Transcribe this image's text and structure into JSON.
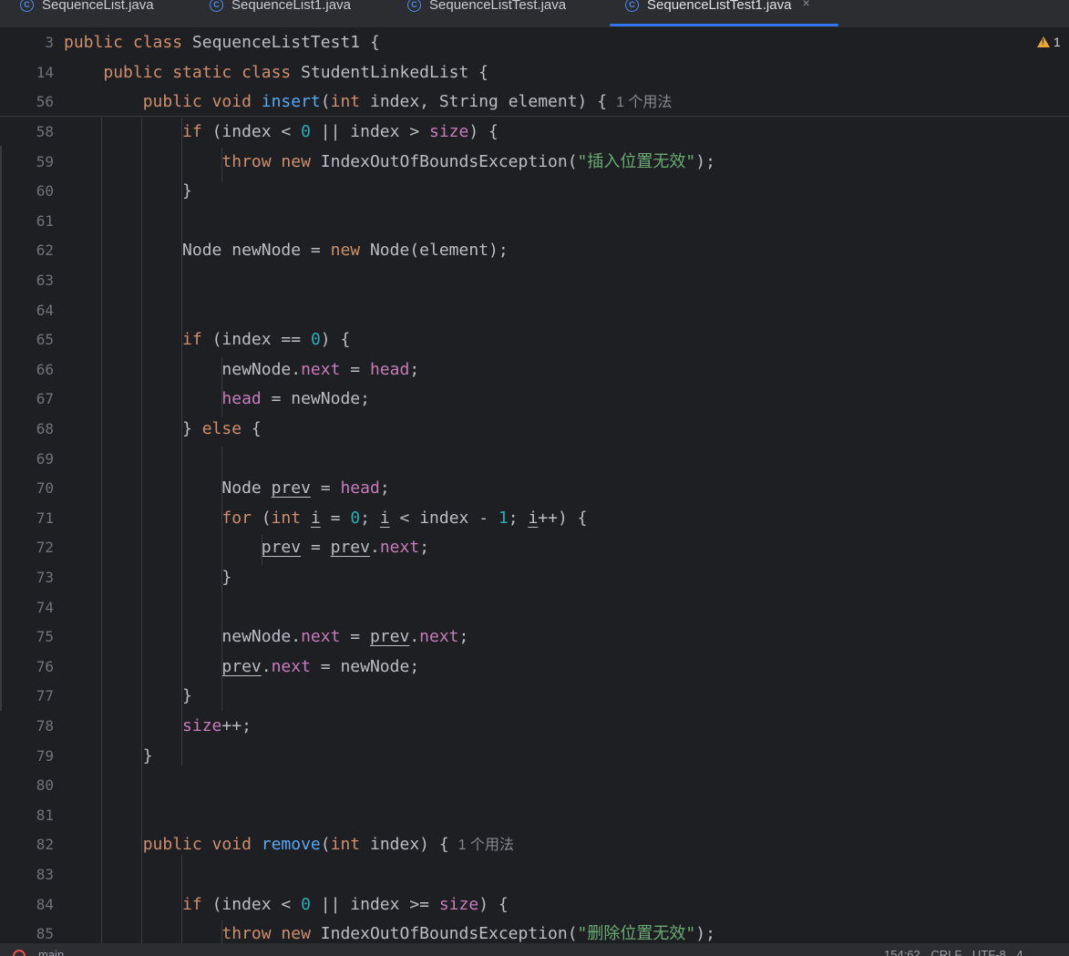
{
  "tabs": [
    {
      "label": "SequenceList.java",
      "icon": "class-icon",
      "active": false
    },
    {
      "label": "SequenceList1.java",
      "icon": "class-icon",
      "active": false
    },
    {
      "label": "SequenceListTest.java",
      "icon": "class-icon",
      "active": false
    },
    {
      "label": "SequenceListTest1.java",
      "icon": "class-icon",
      "active": true
    }
  ],
  "tab_close_glyph": "×",
  "class_icon_glyph": "C",
  "warnings": {
    "count": "1"
  },
  "sticky_lines": [
    {
      "num": "3",
      "tokens": [
        [
          "kw",
          "public "
        ],
        [
          "kw",
          "class "
        ],
        [
          "",
          "SequenceListTest1 {"
        ]
      ]
    },
    {
      "num": "14",
      "tokens": [
        [
          "",
          "    "
        ],
        [
          "kw",
          "public "
        ],
        [
          "kw",
          "static "
        ],
        [
          "kw",
          "class "
        ],
        [
          "",
          "StudentLinkedList {"
        ]
      ]
    },
    {
      "num": "56",
      "tokens": [
        [
          "",
          "        "
        ],
        [
          "kw",
          "public "
        ],
        [
          "kw",
          "void "
        ],
        [
          "fn",
          "insert"
        ],
        [
          "",
          "("
        ],
        [
          "kw",
          "int "
        ],
        [
          "",
          "index, String element) {"
        ],
        [
          "hint",
          "1 个用法"
        ]
      ]
    }
  ],
  "lines": [
    {
      "num": "58",
      "tokens": [
        [
          "",
          "            "
        ],
        [
          "kw",
          "if "
        ],
        [
          "",
          "(index < "
        ],
        [
          "num",
          "0"
        ],
        [
          "",
          " || index > "
        ],
        [
          "fld",
          "size"
        ],
        [
          "",
          ") {"
        ]
      ]
    },
    {
      "num": "59",
      "tokens": [
        [
          "",
          "                "
        ],
        [
          "kw",
          "throw "
        ],
        [
          "kw",
          "new "
        ],
        [
          "",
          "IndexOutOfBoundsException("
        ],
        [
          "str",
          "\"插入位置无效\""
        ],
        [
          "",
          ");"
        ]
      ]
    },
    {
      "num": "60",
      "tokens": [
        [
          "",
          "            }"
        ]
      ]
    },
    {
      "num": "61",
      "tokens": []
    },
    {
      "num": "62",
      "tokens": [
        [
          "",
          "            Node newNode = "
        ],
        [
          "kw",
          "new "
        ],
        [
          "",
          "Node(element);"
        ]
      ]
    },
    {
      "num": "63",
      "tokens": []
    },
    {
      "num": "64",
      "tokens": []
    },
    {
      "num": "65",
      "tokens": [
        [
          "",
          "            "
        ],
        [
          "kw",
          "if "
        ],
        [
          "",
          "(index == "
        ],
        [
          "num",
          "0"
        ],
        [
          "",
          ") {"
        ]
      ]
    },
    {
      "num": "66",
      "tokens": [
        [
          "",
          "                newNode."
        ],
        [
          "fld",
          "next"
        ],
        [
          "",
          " = "
        ],
        [
          "fld",
          "head"
        ],
        [
          "",
          ";"
        ]
      ]
    },
    {
      "num": "67",
      "tokens": [
        [
          "",
          "                "
        ],
        [
          "fld",
          "head"
        ],
        [
          "",
          " = newNode;"
        ]
      ]
    },
    {
      "num": "68",
      "tokens": [
        [
          "",
          "            } "
        ],
        [
          "kw",
          "else "
        ],
        [
          "",
          "{"
        ]
      ]
    },
    {
      "num": "69",
      "tokens": []
    },
    {
      "num": "70",
      "tokens": [
        [
          "",
          "                Node "
        ],
        [
          "ul",
          "prev"
        ],
        [
          "",
          " = "
        ],
        [
          "fld",
          "head"
        ],
        [
          "",
          ";"
        ]
      ]
    },
    {
      "num": "71",
      "tokens": [
        [
          "",
          "                "
        ],
        [
          "kw",
          "for "
        ],
        [
          "",
          "("
        ],
        [
          "kw",
          "int "
        ],
        [
          "ul",
          "i"
        ],
        [
          "",
          " = "
        ],
        [
          "num",
          "0"
        ],
        [
          "",
          "; "
        ],
        [
          "ul",
          "i"
        ],
        [
          "",
          " < index - "
        ],
        [
          "num",
          "1"
        ],
        [
          "",
          "; "
        ],
        [
          "ul",
          "i"
        ],
        [
          "",
          "++) {"
        ]
      ]
    },
    {
      "num": "72",
      "tokens": [
        [
          "",
          "                    "
        ],
        [
          "ul",
          "prev"
        ],
        [
          "",
          " = "
        ],
        [
          "ul",
          "prev"
        ],
        [
          "",
          "."
        ],
        [
          "fld",
          "next"
        ],
        [
          "",
          ";"
        ]
      ]
    },
    {
      "num": "73",
      "tokens": [
        [
          "",
          "                }"
        ]
      ]
    },
    {
      "num": "74",
      "tokens": []
    },
    {
      "num": "75",
      "tokens": [
        [
          "",
          "                newNode."
        ],
        [
          "fld",
          "next"
        ],
        [
          "",
          " = "
        ],
        [
          "ul",
          "prev"
        ],
        [
          "",
          "."
        ],
        [
          "fld",
          "next"
        ],
        [
          "",
          ";"
        ]
      ]
    },
    {
      "num": "76",
      "tokens": [
        [
          "",
          "                "
        ],
        [
          "ul",
          "prev"
        ],
        [
          "",
          "."
        ],
        [
          "fld",
          "next"
        ],
        [
          "",
          " = newNode;"
        ]
      ]
    },
    {
      "num": "77",
      "tokens": [
        [
          "",
          "            }"
        ]
      ]
    },
    {
      "num": "78",
      "tokens": [
        [
          "",
          "            "
        ],
        [
          "fld",
          "size"
        ],
        [
          "",
          "++;"
        ]
      ]
    },
    {
      "num": "79",
      "tokens": [
        [
          "",
          "        }"
        ]
      ]
    },
    {
      "num": "80",
      "tokens": []
    },
    {
      "num": "81",
      "tokens": []
    },
    {
      "num": "82",
      "tokens": [
        [
          "",
          "        "
        ],
        [
          "kw",
          "public "
        ],
        [
          "kw",
          "void "
        ],
        [
          "fn",
          "remove"
        ],
        [
          "",
          "("
        ],
        [
          "kw",
          "int "
        ],
        [
          "",
          "index) {"
        ],
        [
          "hint",
          "1 个用法"
        ]
      ]
    },
    {
      "num": "83",
      "tokens": []
    },
    {
      "num": "84",
      "tokens": [
        [
          "",
          "            "
        ],
        [
          "kw",
          "if "
        ],
        [
          "",
          "(index < "
        ],
        [
          "num",
          "0"
        ],
        [
          "",
          " || index >= "
        ],
        [
          "fld",
          "size"
        ],
        [
          "",
          ") {"
        ]
      ]
    },
    {
      "num": "85",
      "tokens": [
        [
          "",
          "                "
        ],
        [
          "kw",
          "throw "
        ],
        [
          "kw",
          "new "
        ],
        [
          "",
          "IndexOutOfBoundsException("
        ],
        [
          "str",
          "\"删除位置无效\""
        ],
        [
          "",
          ");"
        ]
      ]
    }
  ],
  "statusbar": {
    "left": "main",
    "right": "154:62  CRLF  UTF-8  4"
  }
}
